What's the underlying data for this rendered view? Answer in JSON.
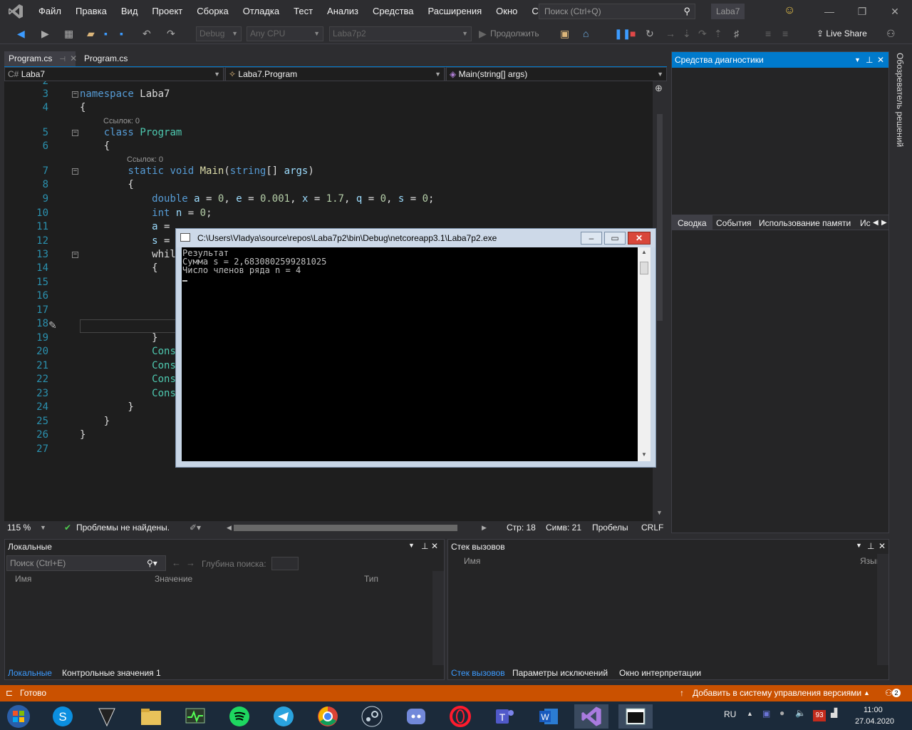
{
  "menu": [
    "Файл",
    "Правка",
    "Вид",
    "Проект",
    "Сборка",
    "Отладка",
    "Тест",
    "Анализ",
    "Средства",
    "Расширения",
    "Окно",
    "Справка"
  ],
  "search": {
    "placeholder": "Поиск (Ctrl+Q)"
  },
  "solution_name": "Laba7",
  "toolbar": {
    "config": "Debug",
    "platform": "Any CPU",
    "startup": "Laba7p2",
    "continue_label": "Продолжить",
    "live_share": "Live Share"
  },
  "doc_tabs": [
    "Program.cs",
    "Program.cs"
  ],
  "nav": {
    "project": "Laba7",
    "class": "Laba7.Program",
    "member": "Main(string[] args)"
  },
  "editor": {
    "refs_label": "Ссылок: 0",
    "lines": [
      {
        "n": "2",
        "code": ""
      },
      {
        "n": "3",
        "code": "namespace Laba7"
      },
      {
        "n": "4",
        "code": "{"
      },
      {
        "n": "5",
        "code": "    class Program"
      },
      {
        "n": "6",
        "code": "    {"
      },
      {
        "n": "7",
        "code": "        static void Main(string[] args)"
      },
      {
        "n": "8",
        "code": "        {"
      },
      {
        "n": "9",
        "code": "            double a = 0, e = 0.001, x = 1.7, q = 0, s = 0;"
      },
      {
        "n": "10",
        "code": "            int n = 0;"
      },
      {
        "n": "11",
        "code": "            a = "
      },
      {
        "n": "12",
        "code": "            s = "
      },
      {
        "n": "13",
        "code": "            whil"
      },
      {
        "n": "14",
        "code": "            {"
      },
      {
        "n": "15",
        "code": ""
      },
      {
        "n": "16",
        "code": ""
      },
      {
        "n": "17",
        "code": ""
      },
      {
        "n": "18",
        "code": ""
      },
      {
        "n": "19",
        "code": "            }"
      },
      {
        "n": "20",
        "code": "            Cons"
      },
      {
        "n": "21",
        "code": "            Cons"
      },
      {
        "n": "22",
        "code": "            Cons"
      },
      {
        "n": "23",
        "code": "            Cons"
      },
      {
        "n": "24",
        "code": "        }"
      },
      {
        "n": "25",
        "code": "    }"
      },
      {
        "n": "26",
        "code": "}"
      },
      {
        "n": "27",
        "code": ""
      }
    ]
  },
  "editor_status": {
    "zoom": "115 %",
    "issues": "Проблемы не найдены.",
    "line": "Стр: 18",
    "col": "Симв: 21",
    "spaces": "Пробелы",
    "eol": "CRLF"
  },
  "diagnostics": {
    "title": "Средства диагностики",
    "tabs": [
      "Сводка",
      "События",
      "Использование памяти",
      "Ис"
    ]
  },
  "solution_explorer": "Обозреватель решений",
  "console": {
    "title": "C:\\Users\\Vladya\\source\\repos\\Laba7p2\\bin\\Debug\\netcoreapp3.1\\Laba7p2.exe",
    "lines": [
      "Результат",
      "Сумма s = 2,6830802599281025",
      "Число членов ряда n = 4"
    ]
  },
  "locals": {
    "title": "Локальные",
    "search_placeholder": "Поиск (Ctrl+E)",
    "depth_label": "Глубина поиска:",
    "columns": [
      "Имя",
      "Значение",
      "Тип"
    ],
    "tabs": [
      "Локальные",
      "Контрольные значения 1"
    ]
  },
  "callstack": {
    "title": "Стек вызовов",
    "columns": [
      "Имя",
      "Язык"
    ],
    "tabs": [
      "Стек вызовов",
      "Параметры исключений",
      "Окно интерпретации"
    ]
  },
  "status": {
    "ready": "Готово",
    "vcs": "Добавить в систему управления версиями",
    "notifications": "2"
  },
  "taskbar": {
    "lang": "RU",
    "time": "11:00",
    "date": "27.04.2020",
    "badge": "93"
  },
  "colors": {
    "accent": "#007acc",
    "status": "#ca5100"
  }
}
